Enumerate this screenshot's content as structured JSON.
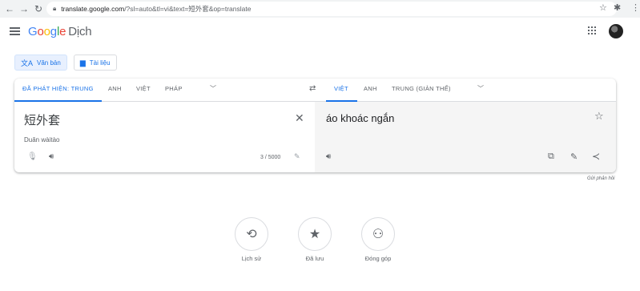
{
  "browser": {
    "url_host": "translate.google.com",
    "url_path": "/?sl=auto&tl=vi&text=短外套&op=translate"
  },
  "app": {
    "logo_letters": [
      "G",
      "o",
      "o",
      "g",
      "l",
      "e"
    ],
    "product_name": "Dịch"
  },
  "modes": [
    {
      "label": "Văn bản",
      "icon": "translate-icon",
      "active": true
    },
    {
      "label": "Tài liệu",
      "icon": "document-icon",
      "active": false
    }
  ],
  "source_langs": [
    "ĐÃ PHÁT HIỆN: TRUNG",
    "ANH",
    "VIỆT",
    "PHÁP"
  ],
  "target_langs": [
    "VIỆT",
    "ANH",
    "TRUNG (GIẢN THỂ)"
  ],
  "source": {
    "text": "短外套",
    "transliteration": "Duǎn wàitào",
    "char_count": "3 / 5000"
  },
  "target": {
    "text": "áo khoác ngắn"
  },
  "feedback_label": "Gửi phản hồi",
  "bottom_actions": [
    {
      "label": "Lịch sử",
      "icon": "history-icon"
    },
    {
      "label": "Đã lưu",
      "icon": "star-icon"
    },
    {
      "label": "Đóng góp",
      "icon": "contribute-icon"
    }
  ],
  "colors": {
    "accent": "#1a73e8",
    "target_panel_bg": "#f5f5f5"
  }
}
